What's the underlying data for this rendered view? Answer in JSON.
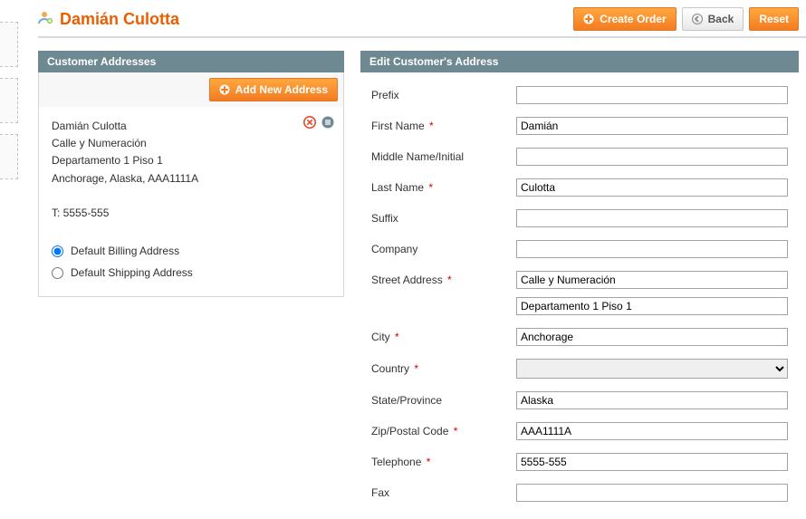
{
  "page": {
    "title": "Damián Culotta"
  },
  "toolbar": {
    "create_order": "Create Order",
    "back": "Back",
    "reset": "Reset"
  },
  "addresses": {
    "header": "Customer Addresses",
    "add_new": "Add New Address",
    "card": {
      "name": "Damián Culotta",
      "line1": "Calle y Numeración",
      "line2": "Departamento 1 Piso 1",
      "city_state_zip": "Anchorage, Alaska, AAA1111A",
      "phone": "T: 5555-555"
    },
    "defaults": {
      "billing": "Default Billing Address",
      "shipping": "Default Shipping Address"
    }
  },
  "form": {
    "header": "Edit Customer's Address",
    "labels": {
      "prefix": "Prefix",
      "first_name": "First Name",
      "middle": "Middle Name/Initial",
      "last_name": "Last Name",
      "suffix": "Suffix",
      "company": "Company",
      "street": "Street Address",
      "city": "City",
      "country": "Country",
      "state": "State/Province",
      "zip": "Zip/Postal Code",
      "telephone": "Telephone",
      "fax": "Fax"
    },
    "values": {
      "prefix": "",
      "first_name": "Damián",
      "middle": "",
      "last_name": "Culotta",
      "suffix": "",
      "company": "",
      "street1": "Calle y Numeración",
      "street2": "Departamento 1 Piso 1",
      "city": "Anchorage",
      "country": "",
      "state": "Alaska",
      "zip": "AAA1111A",
      "telephone": "5555-555",
      "fax": ""
    }
  }
}
